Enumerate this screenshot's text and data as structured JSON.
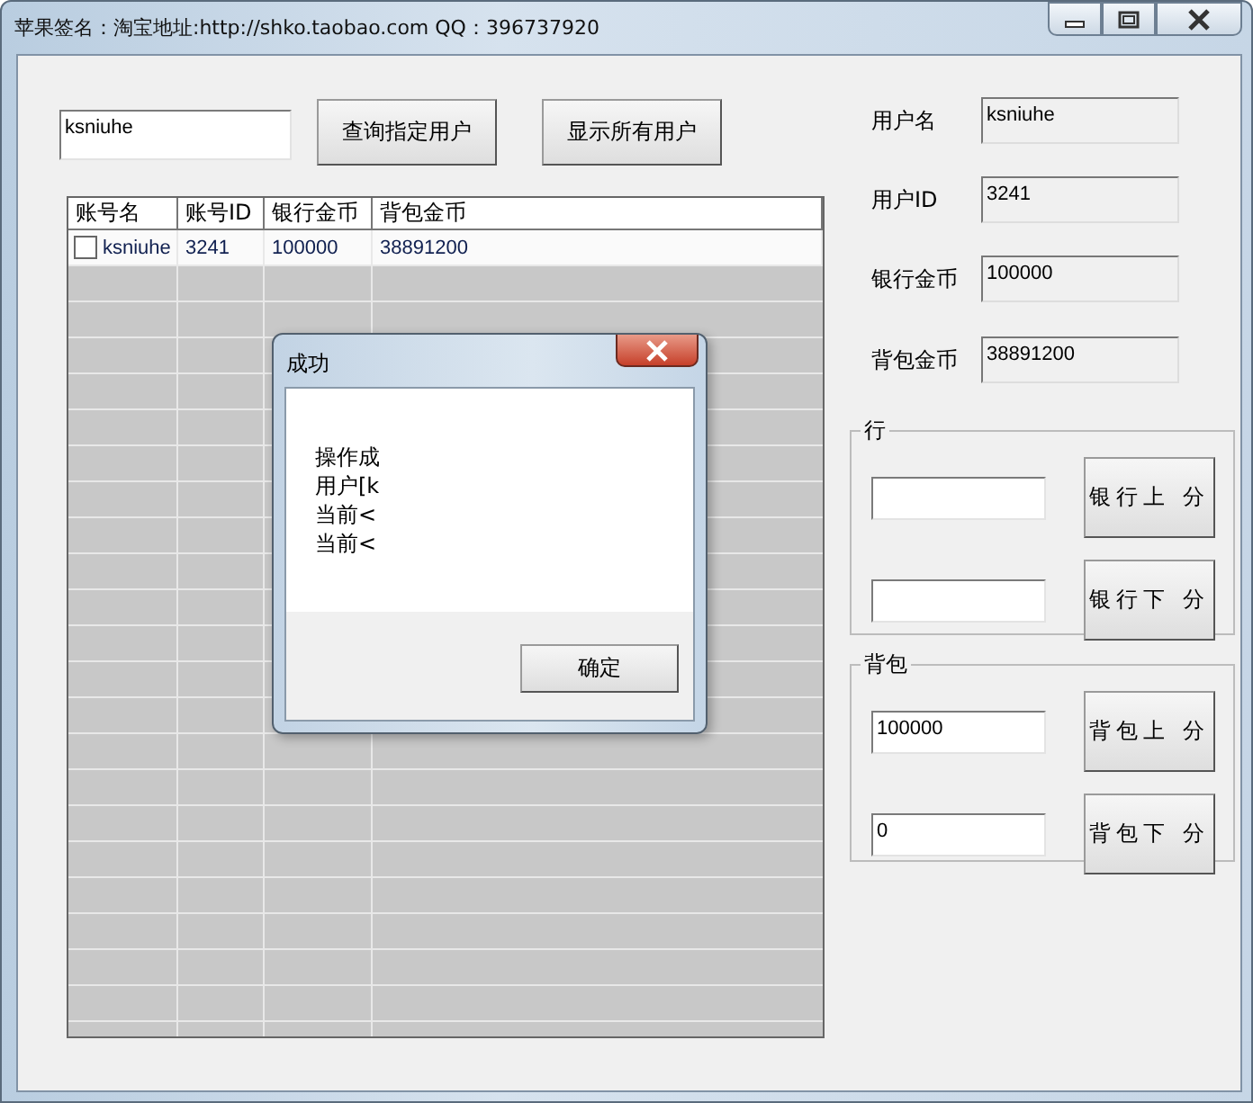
{
  "window": {
    "title": "苹果签名：淘宝地址:http://shko.taobao.com QQ：396737920"
  },
  "search": {
    "value": "ksniuhe"
  },
  "buttons": [
    "查询指定用户",
    "显示所有用户"
  ],
  "table": {
    "columns": [
      "账号名",
      "账号ID",
      "银行金币",
      "背包金币"
    ],
    "rows": [
      {
        "checked": false,
        "cells": [
          "ksniuhe",
          "3241",
          "100000",
          "38891200"
        ]
      }
    ]
  },
  "details": [
    {
      "label": "用户名",
      "value": "ksniuhe"
    },
    {
      "label": "用户ID",
      "value": "3241"
    },
    {
      "label": "银行金币",
      "value": "100000"
    },
    {
      "label": "背包金币",
      "value": "38891200"
    }
  ],
  "groups": [
    {
      "title": "行",
      "rows": [
        {
          "button": "银行上 分"
        },
        {
          "button": "银行下 分"
        }
      ]
    },
    {
      "title": "背包",
      "rows": [
        {
          "value": "100000",
          "button": "背包上 分"
        },
        {
          "value": "0",
          "button": "背包下 分"
        }
      ]
    }
  ],
  "dialog": {
    "title": "成功",
    "lines": [
      "操作成",
      "用户[k",
      "当前<",
      "当前<"
    ],
    "button": "确定"
  }
}
